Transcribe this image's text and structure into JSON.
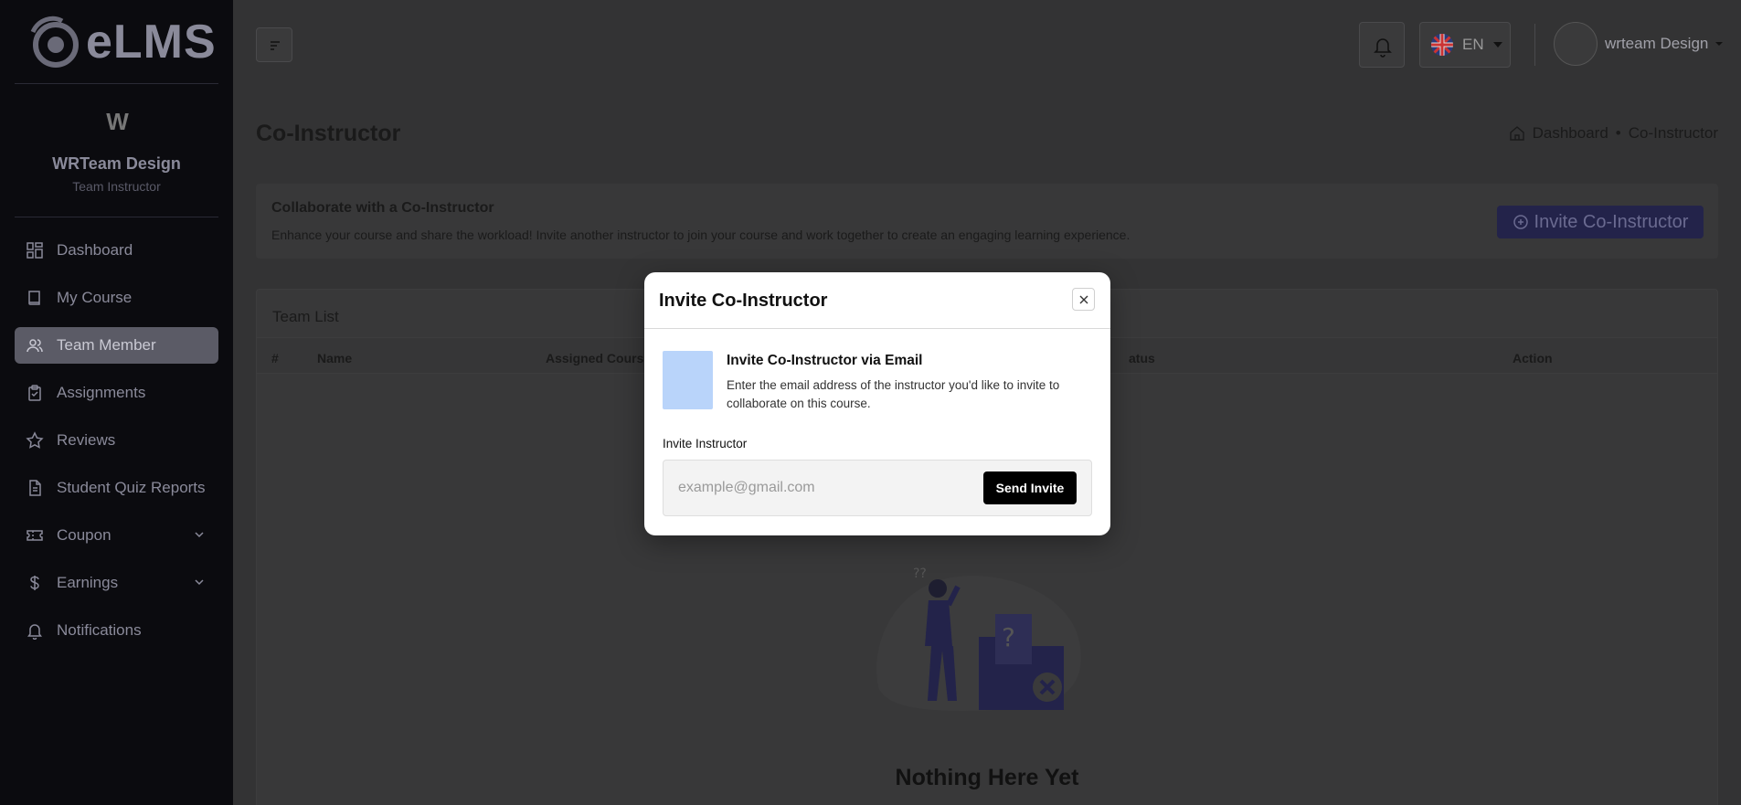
{
  "brand": {
    "name": "eLMS"
  },
  "profile": {
    "initial": "W",
    "name": "WRTeam Design",
    "role": "Team Instructor"
  },
  "sidebar": {
    "items": [
      {
        "label": "Dashboard",
        "icon": "grid-icon"
      },
      {
        "label": "My Course",
        "icon": "book-icon"
      },
      {
        "label": "Team Member",
        "icon": "users-icon",
        "active": true
      },
      {
        "label": "Assignments",
        "icon": "clipboard-icon"
      },
      {
        "label": "Reviews",
        "icon": "star-icon"
      },
      {
        "label": "Student Quiz Reports",
        "icon": "document-icon"
      },
      {
        "label": "Coupon",
        "icon": "ticket-icon",
        "expandable": true
      },
      {
        "label": "Earnings",
        "icon": "dollar-icon",
        "expandable": true
      },
      {
        "label": "Notifications",
        "icon": "bell-icon"
      }
    ]
  },
  "topbar": {
    "language": "EN",
    "user_name": "wrteam Design"
  },
  "page": {
    "title": "Co-Instructor",
    "breadcrumb": {
      "home": "Dashboard",
      "separator": "•",
      "current": "Co-Instructor"
    }
  },
  "collab": {
    "title": "Collaborate with a Co-Instructor",
    "description": "Enhance your course and share the workload! Invite another instructor to join your course and work together to create an engaging learning experience.",
    "button_label": "Invite Co-Instructor"
  },
  "team": {
    "title": "Team List",
    "columns": [
      "#",
      "Name",
      "Assigned Cours",
      "atus",
      "Action"
    ],
    "empty_title": "Nothing Here Yet"
  },
  "modal": {
    "title": "Invite Co-Instructor",
    "info_title": "Invite Co-Instructor via Email",
    "info_desc": "Enter the email address of the instructor you'd like to invite to collaborate on this course.",
    "field_label": "Invite Instructor",
    "email_placeholder": "example@gmail.com",
    "email_value": "",
    "send_label": "Send Invite"
  },
  "colors": {
    "accent": "#23234a",
    "modal_info": "#b9d4fa",
    "send_button": "#000000"
  }
}
